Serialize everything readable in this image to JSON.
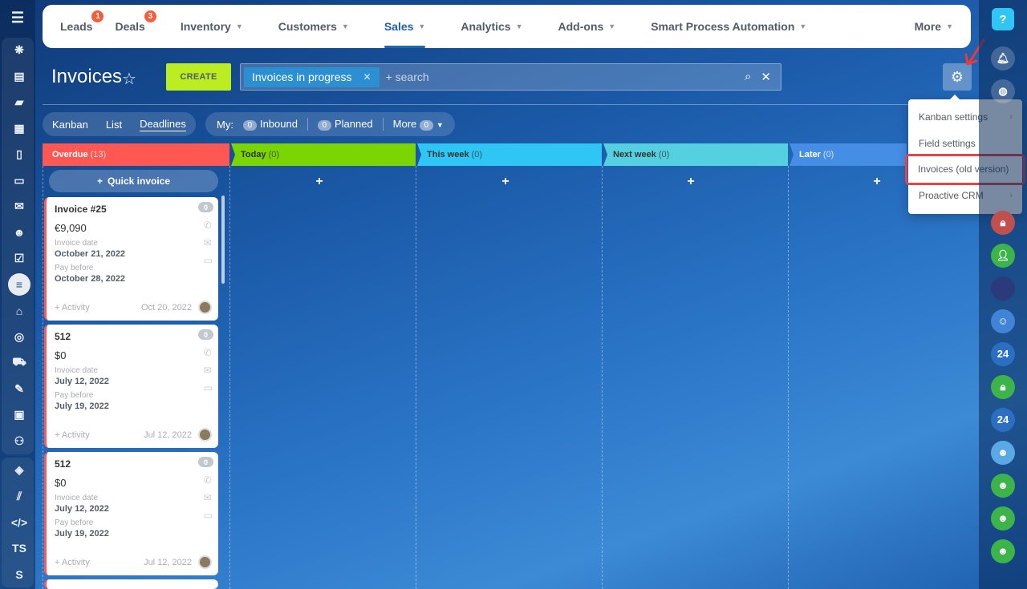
{
  "nav": {
    "items": [
      {
        "label": "Leads",
        "badge": "1"
      },
      {
        "label": "Deals",
        "badge": "3"
      },
      {
        "label": "Inventory",
        "chevron": true
      },
      {
        "label": "Customers",
        "chevron": true
      },
      {
        "label": "Sales",
        "chevron": true,
        "active": true
      },
      {
        "label": "Analytics",
        "chevron": true
      },
      {
        "label": "Add-ons",
        "chevron": true
      },
      {
        "label": "Smart Process Automation",
        "chevron": true
      }
    ],
    "more": "More"
  },
  "page": {
    "title": "Invoices",
    "create_label": "CREATE",
    "filter_chip": "Invoices in progress",
    "search_placeholder": "+ search"
  },
  "views": {
    "kanban": "Kanban",
    "list": "List",
    "deadlines": "Deadlines"
  },
  "counters": {
    "my": "My:",
    "inbound_count": "0",
    "inbound": "Inbound",
    "planned_count": "0",
    "planned": "Planned",
    "more": "More",
    "more_count": "0"
  },
  "columns": [
    {
      "name": "Overdue",
      "count": "(13)",
      "color": "#ff5752"
    },
    {
      "name": "Today",
      "count": "(0)",
      "color": "#7bd500"
    },
    {
      "name": "This week",
      "count": "(0)",
      "color": "#2fc6f6"
    },
    {
      "name": "Next week",
      "count": "(0)",
      "color": "#55d0e0"
    },
    {
      "name": "Later",
      "count": "(0)",
      "color": "#468ee5"
    }
  ],
  "quick_invoice": "Quick invoice",
  "cards": [
    {
      "title": "Invoice #25",
      "amount": "€9,090",
      "date_label": "Invoice date",
      "date": "October 21, 2022",
      "pay_label": "Pay before",
      "pay": "October 28, 2022",
      "activity": "+ Activity",
      "created": "Oct 20, 2022",
      "counter": "0"
    },
    {
      "title": "512",
      "amount": "$0",
      "date_label": "Invoice date",
      "date": "July 12, 2022",
      "pay_label": "Pay before",
      "pay": "July 19, 2022",
      "activity": "+ Activity",
      "created": "Jul 12, 2022",
      "counter": "0"
    },
    {
      "title": "512",
      "amount": "$0",
      "date_label": "Invoice date",
      "date": "July 12, 2022",
      "pay_label": "Pay before",
      "pay": "July 19, 2022",
      "activity": "+ Activity",
      "created": "Jul 12, 2022",
      "counter": "0"
    }
  ],
  "settings_menu": {
    "items": [
      {
        "label": "Kanban settings",
        "submenu": true
      },
      {
        "label": "Field settings",
        "submenu": false
      },
      {
        "label": "Invoices (old version)",
        "submenu": false,
        "highlighted": true
      },
      {
        "label": "Proactive CRM",
        "submenu": true
      }
    ]
  },
  "left_rail": {
    "bottom_labels": [
      "TS",
      "S"
    ]
  },
  "right_rail": {
    "help": "?",
    "badges_24": "24"
  },
  "colors": {
    "accent": "#2066b0",
    "create_button": "#bbed21",
    "highlight_outline": "#e1464f"
  }
}
